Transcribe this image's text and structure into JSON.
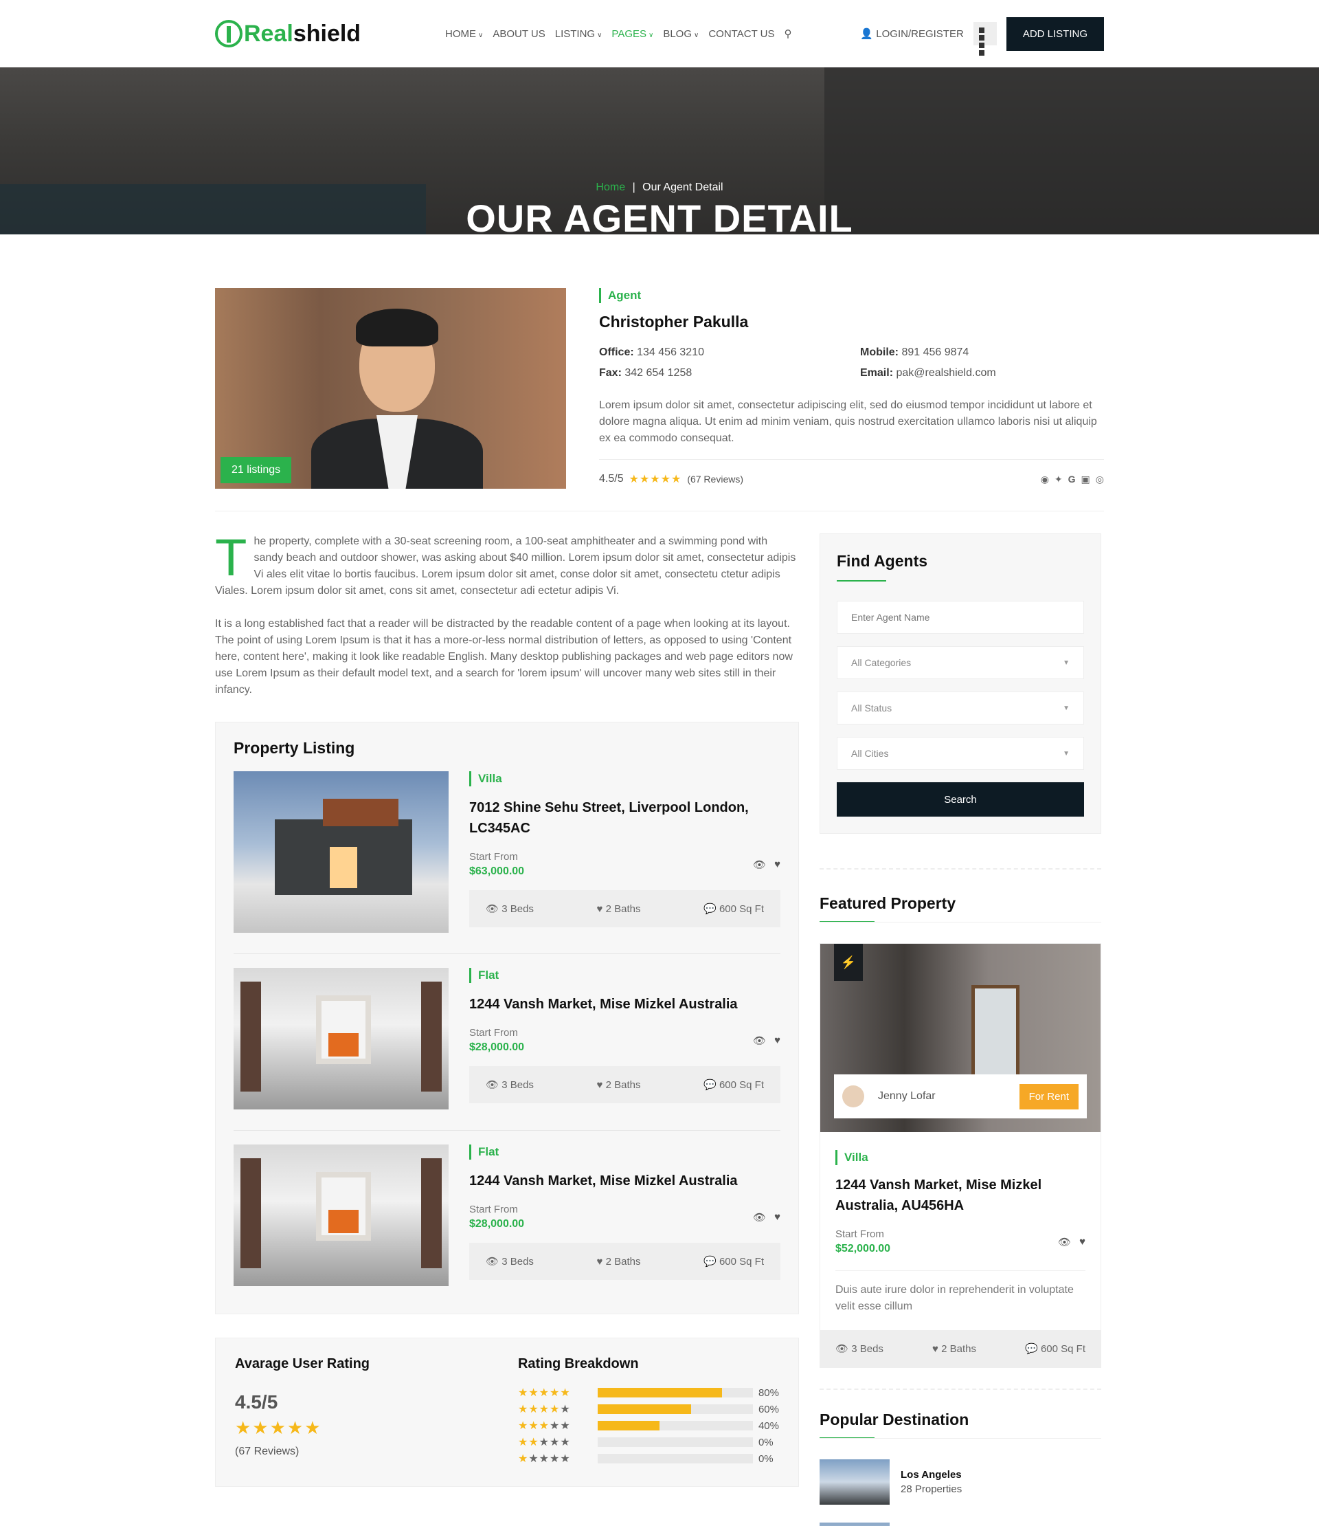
{
  "header": {
    "logo_prefix": "Real",
    "logo_suffix": "shield",
    "nav": [
      {
        "label": "HOME",
        "chevron": true
      },
      {
        "label": "ABOUT US",
        "chevron": false
      },
      {
        "label": "LISTING",
        "chevron": true
      },
      {
        "label": "PAGES",
        "chevron": true,
        "active": true
      },
      {
        "label": "BLOG",
        "chevron": true
      },
      {
        "label": "CONTACT US",
        "chevron": false
      }
    ],
    "login": "LOGIN/REGISTER",
    "add_listing": "ADD LISTING"
  },
  "hero": {
    "crumb_home": "Home",
    "crumb_sep": "|",
    "crumb_current": "Our Agent Detail",
    "title": "OUR AGENT DETAIL"
  },
  "agent": {
    "listings_badge": "21 listings",
    "role": "Agent",
    "name": "Christopher Pakulla",
    "office_label": "Office:",
    "office": "134 456 3210",
    "mobile_label": "Mobile:",
    "mobile": "891 456 9874",
    "fax_label": "Fax:",
    "fax": "342 654 1258",
    "email_label": "Email:",
    "email": "pak@realshield.com",
    "description": "Lorem ipsum dolor sit amet, consectetur adipiscing elit, sed do eiusmod tempor incididunt ut labore et dolore magna aliqua. Ut enim ad minim veniam, quis nostrud exercitation ullamco laboris nisi ut aliquip ex ea commodo consequat.",
    "rating": "4.5/5",
    "reviews": "(67 Reviews)"
  },
  "content": {
    "dropcap": "T",
    "para1": "he property, complete with a 30-seat screening room, a 100-seat amphitheater and a swimming pond with sandy beach and outdoor shower, was asking about $40 million. Lorem ipsum dolor sit amet, consectetur adipis Vi ales elit vitae lo bortis faucibus. Lorem ipsum dolor sit amet, conse dolor sit amet, consectetu ctetur adipis Viales. Lorem ipsum dolor sit amet, cons sit amet, consectetur adi ectetur adipis Vi.",
    "para2": "It is a long established fact that a reader will be distracted by the readable content of a page when looking at its layout. The point of using Lorem Ipsum is that it has a more-or-less normal distribution of letters, as opposed to using 'Content here, content here', making it look like readable English. Many desktop publishing packages and web page editors now use Lorem Ipsum as their default model text, and a search for 'lorem ipsum' will uncover many web sites still in their infancy."
  },
  "listing": {
    "title": "Property Listing",
    "start_label": "Start From",
    "items": [
      {
        "type": "Villa",
        "title": "7012 Shine Sehu Street, Liverpool London, LC345AC",
        "price": "$63,000.00",
        "beds": "3 Beds",
        "baths": "2 Baths",
        "area": "600 Sq Ft"
      },
      {
        "type": "Flat",
        "title": "1244 Vansh Market, Mise Mizkel Australia",
        "price": "$28,000.00",
        "beds": "3 Beds",
        "baths": "2 Baths",
        "area": "600 Sq Ft"
      },
      {
        "type": "Flat",
        "title": "1244 Vansh Market, Mise Mizkel Australia",
        "price": "$28,000.00",
        "beds": "3 Beds",
        "baths": "2 Baths",
        "area": "600 Sq Ft"
      }
    ]
  },
  "ratings": {
    "avg_title": "Avarage User Rating",
    "avg_value": "4.5/5",
    "avg_reviews": "(67 Reviews)",
    "breakdown_title": "Rating Breakdown",
    "rows": [
      {
        "stars": 5,
        "percent": 80,
        "label": "80%"
      },
      {
        "stars": 4,
        "percent": 60,
        "label": "60%"
      },
      {
        "stars": 3,
        "percent": 40,
        "label": "40%"
      },
      {
        "stars": 2,
        "percent": 0,
        "label": "0%"
      },
      {
        "stars": 1,
        "percent": 0,
        "label": "0%"
      }
    ]
  },
  "sidebar": {
    "find_title": "Find Agents",
    "name_placeholder": "Enter Agent Name",
    "categories": "All Categories",
    "status": "All Status",
    "cities": "All Cities",
    "search": "Search",
    "featured_title": "Featured Property",
    "featured": {
      "owner": "Jenny Lofar",
      "badge": "For Rent",
      "type": "Villa",
      "title": "1244 Vansh Market, Mise Mizkel Australia, AU456HA",
      "start_label": "Start From",
      "price": "$52,000.00",
      "desc": "Duis aute irure dolor in reprehenderit in voluptate velit esse cillum",
      "beds": "3 Beds",
      "baths": "2 Baths",
      "area": "600 Sq Ft"
    },
    "popular_title": "Popular Destination",
    "destination": {
      "name": "Los Angeles",
      "count": "28 Properties"
    }
  },
  "colors": {
    "accent": "#2bb24c",
    "dark": "#0d1b24",
    "star": "#f6b81a",
    "rent": "#f6a826"
  }
}
